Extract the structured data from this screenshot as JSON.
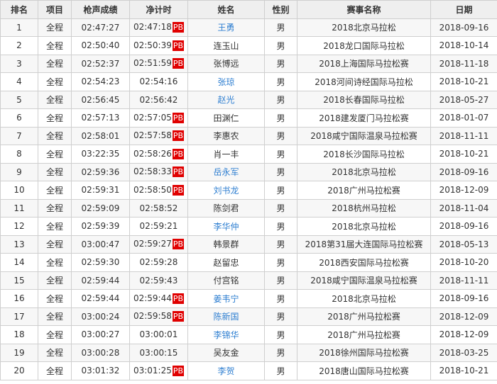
{
  "table": {
    "headers": {
      "rank": "排名",
      "event": "项目",
      "gun_time": "枪声成绩",
      "net_time": "净计时",
      "name": "姓名",
      "gender": "性别",
      "race": "赛事名称",
      "date": "日期"
    },
    "pb_label": "PB",
    "link_color": "#2f7fd1",
    "pb_color": "#e00000",
    "rows": [
      {
        "rank": "1",
        "event": "全程",
        "gun_time": "02:47:27",
        "net_time": "02:47:18",
        "pb": true,
        "name": "王勇",
        "linked": true,
        "gender": "男",
        "race": "2018北京马拉松",
        "date": "2018-09-16"
      },
      {
        "rank": "2",
        "event": "全程",
        "gun_time": "02:50:40",
        "net_time": "02:50:39",
        "pb": true,
        "name": "连玉山",
        "linked": false,
        "gender": "男",
        "race": "2018龙口国际马拉松",
        "date": "2018-10-14"
      },
      {
        "rank": "3",
        "event": "全程",
        "gun_time": "02:52:37",
        "net_time": "02:51:59",
        "pb": true,
        "name": "张博远",
        "linked": false,
        "gender": "男",
        "race": "2018上海国际马拉松赛",
        "date": "2018-11-18"
      },
      {
        "rank": "4",
        "event": "全程",
        "gun_time": "02:54:23",
        "net_time": "02:54:16",
        "pb": false,
        "name": "张琼",
        "linked": true,
        "gender": "男",
        "race": "2018河间诗经国际马拉松",
        "date": "2018-10-21"
      },
      {
        "rank": "5",
        "event": "全程",
        "gun_time": "02:56:45",
        "net_time": "02:56:42",
        "pb": false,
        "name": "赵光",
        "linked": true,
        "gender": "男",
        "race": "2018长春国际马拉松",
        "date": "2018-05-27"
      },
      {
        "rank": "6",
        "event": "全程",
        "gun_time": "02:57:13",
        "net_time": "02:57:05",
        "pb": true,
        "name": "田渊仁",
        "linked": false,
        "gender": "男",
        "race": "2018建发厦门马拉松赛",
        "date": "2018-01-07"
      },
      {
        "rank": "7",
        "event": "全程",
        "gun_time": "02:58:01",
        "net_time": "02:57:58",
        "pb": true,
        "name": "李惠农",
        "linked": false,
        "gender": "男",
        "race": "2018咸宁国际温泉马拉松赛",
        "date": "2018-11-11"
      },
      {
        "rank": "8",
        "event": "全程",
        "gun_time": "03:22:35",
        "net_time": "02:58:26",
        "pb": true,
        "name": "肖一丰",
        "linked": false,
        "gender": "男",
        "race": "2018长沙国际马拉松",
        "date": "2018-10-21"
      },
      {
        "rank": "9",
        "event": "全程",
        "gun_time": "02:59:36",
        "net_time": "02:58:33",
        "pb": true,
        "name": "岳永军",
        "linked": true,
        "gender": "男",
        "race": "2018北京马拉松",
        "date": "2018-09-16"
      },
      {
        "rank": "10",
        "event": "全程",
        "gun_time": "02:59:31",
        "net_time": "02:58:50",
        "pb": true,
        "name": "刘书龙",
        "linked": true,
        "gender": "男",
        "race": "2018广州马拉松赛",
        "date": "2018-12-09"
      },
      {
        "rank": "11",
        "event": "全程",
        "gun_time": "02:59:09",
        "net_time": "02:58:52",
        "pb": false,
        "name": "陈剑君",
        "linked": false,
        "gender": "男",
        "race": "2018杭州马拉松",
        "date": "2018-11-04"
      },
      {
        "rank": "12",
        "event": "全程",
        "gun_time": "02:59:39",
        "net_time": "02:59:21",
        "pb": false,
        "name": "李华仲",
        "linked": true,
        "gender": "男",
        "race": "2018北京马拉松",
        "date": "2018-09-16"
      },
      {
        "rank": "13",
        "event": "全程",
        "gun_time": "03:00:47",
        "net_time": "02:59:27",
        "pb": true,
        "name": "韩景群",
        "linked": false,
        "gender": "男",
        "race": "2018第31届大连国际马拉松赛",
        "date": "2018-05-13"
      },
      {
        "rank": "14",
        "event": "全程",
        "gun_time": "02:59:30",
        "net_time": "02:59:28",
        "pb": false,
        "name": "赵留忠",
        "linked": false,
        "gender": "男",
        "race": "2018西安国际马拉松赛",
        "date": "2018-10-20"
      },
      {
        "rank": "15",
        "event": "全程",
        "gun_time": "02:59:44",
        "net_time": "02:59:43",
        "pb": false,
        "name": "付宫铭",
        "linked": false,
        "gender": "男",
        "race": "2018咸宁国际温泉马拉松赛",
        "date": "2018-11-11"
      },
      {
        "rank": "16",
        "event": "全程",
        "gun_time": "02:59:44",
        "net_time": "02:59:44",
        "pb": true,
        "name": "姜韦宁",
        "linked": true,
        "gender": "男",
        "race": "2018北京马拉松",
        "date": "2018-09-16"
      },
      {
        "rank": "17",
        "event": "全程",
        "gun_time": "03:00:24",
        "net_time": "02:59:58",
        "pb": true,
        "name": "陈新国",
        "linked": true,
        "gender": "男",
        "race": "2018广州马拉松赛",
        "date": "2018-12-09"
      },
      {
        "rank": "18",
        "event": "全程",
        "gun_time": "03:00:27",
        "net_time": "03:00:01",
        "pb": false,
        "name": "李锦华",
        "linked": true,
        "gender": "男",
        "race": "2018广州马拉松赛",
        "date": "2018-12-09"
      },
      {
        "rank": "19",
        "event": "全程",
        "gun_time": "03:00:28",
        "net_time": "03:00:15",
        "pb": false,
        "name": "吴友金",
        "linked": false,
        "gender": "男",
        "race": "2018徐州国际马拉松赛",
        "date": "2018-03-25"
      },
      {
        "rank": "20",
        "event": "全程",
        "gun_time": "03:01:32",
        "net_time": "03:01:25",
        "pb": true,
        "name": "李贺",
        "linked": true,
        "gender": "男",
        "race": "2018唐山国际马拉松赛",
        "date": "2018-10-21"
      }
    ]
  }
}
